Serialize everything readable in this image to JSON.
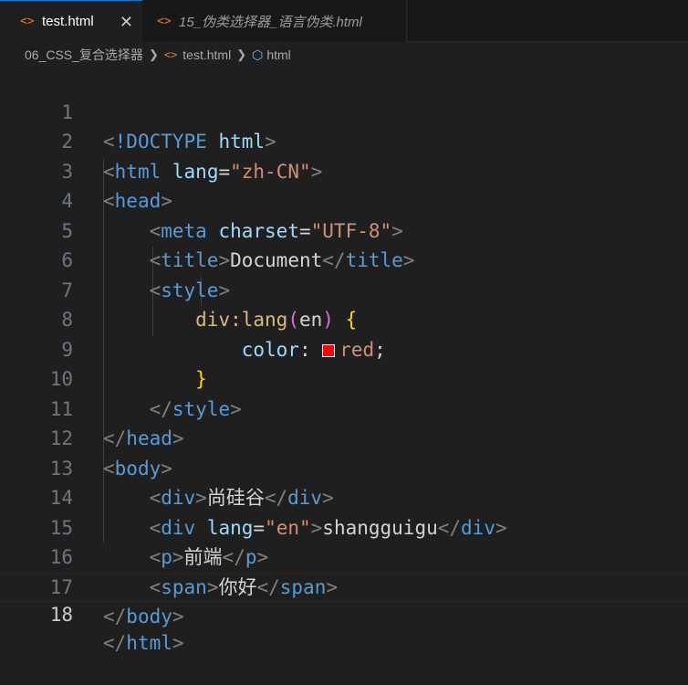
{
  "tabs": [
    {
      "icon": "html-file-icon",
      "label": "test.html",
      "active": true,
      "close_glyph": "✕"
    },
    {
      "icon": "html-file-icon",
      "label": "15_伪类选择器_语言伪类.html",
      "active": false
    }
  ],
  "breadcrumb": {
    "folder": "06_CSS_复合选择器",
    "file": "test.html",
    "symbol": "html"
  },
  "editor": {
    "current_line": 18,
    "color_swatch": "#ff0000",
    "lines": [
      {
        "n": "1"
      },
      {
        "n": "2"
      },
      {
        "n": "3"
      },
      {
        "n": "4"
      },
      {
        "n": "5"
      },
      {
        "n": "6"
      },
      {
        "n": "7"
      },
      {
        "n": "8"
      },
      {
        "n": "9"
      },
      {
        "n": "10"
      },
      {
        "n": "11"
      },
      {
        "n": "12"
      },
      {
        "n": "13"
      },
      {
        "n": "14"
      },
      {
        "n": "15"
      },
      {
        "n": "16"
      },
      {
        "n": "17"
      },
      {
        "n": "18"
      }
    ],
    "tokens": {
      "doctype": "!DOCTYPE",
      "html": "html",
      "lang": "lang",
      "zh_cn": "\"zh-CN\"",
      "head": "head",
      "meta": "meta",
      "charset": "charset",
      "utf8": "\"UTF-8\"",
      "title": "title",
      "document": "Document",
      "style": "style",
      "selector": "div:lang",
      "en_arg": "en",
      "color_prop": "color",
      "red": "red",
      "body": "body",
      "div": "div",
      "text13": "尚硅谷",
      "en_str": "\"en\"",
      "text14": "shangguigu",
      "p": "p",
      "text15": "前端",
      "span": "span",
      "text16": "你好"
    }
  }
}
